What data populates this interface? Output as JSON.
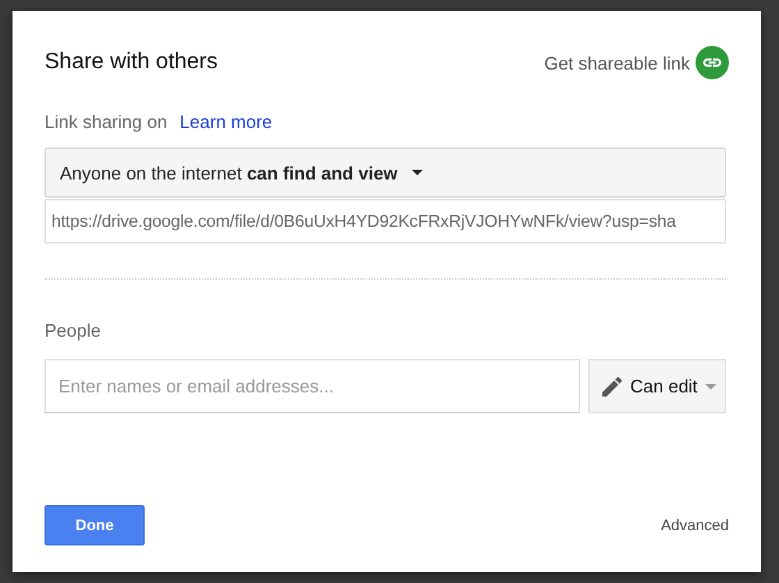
{
  "dialog": {
    "title": "Share with others",
    "shareable_link": "Get shareable link"
  },
  "link_sharing": {
    "status": "Link sharing on",
    "learn_more": "Learn more",
    "access": "Anyone on the internet **can find and view**",
    "url": "https://drive.google.com/file/d/0B6uUxH4YD92KcFRxRjVJOHYwNFk/view?usp=sha"
  },
  "people": {
    "label": "People",
    "placeholder": "Enter names or email addresses...",
    "permission": "Can edit"
  },
  "footer": {
    "done": "Done",
    "advanced": "Advanced"
  }
}
